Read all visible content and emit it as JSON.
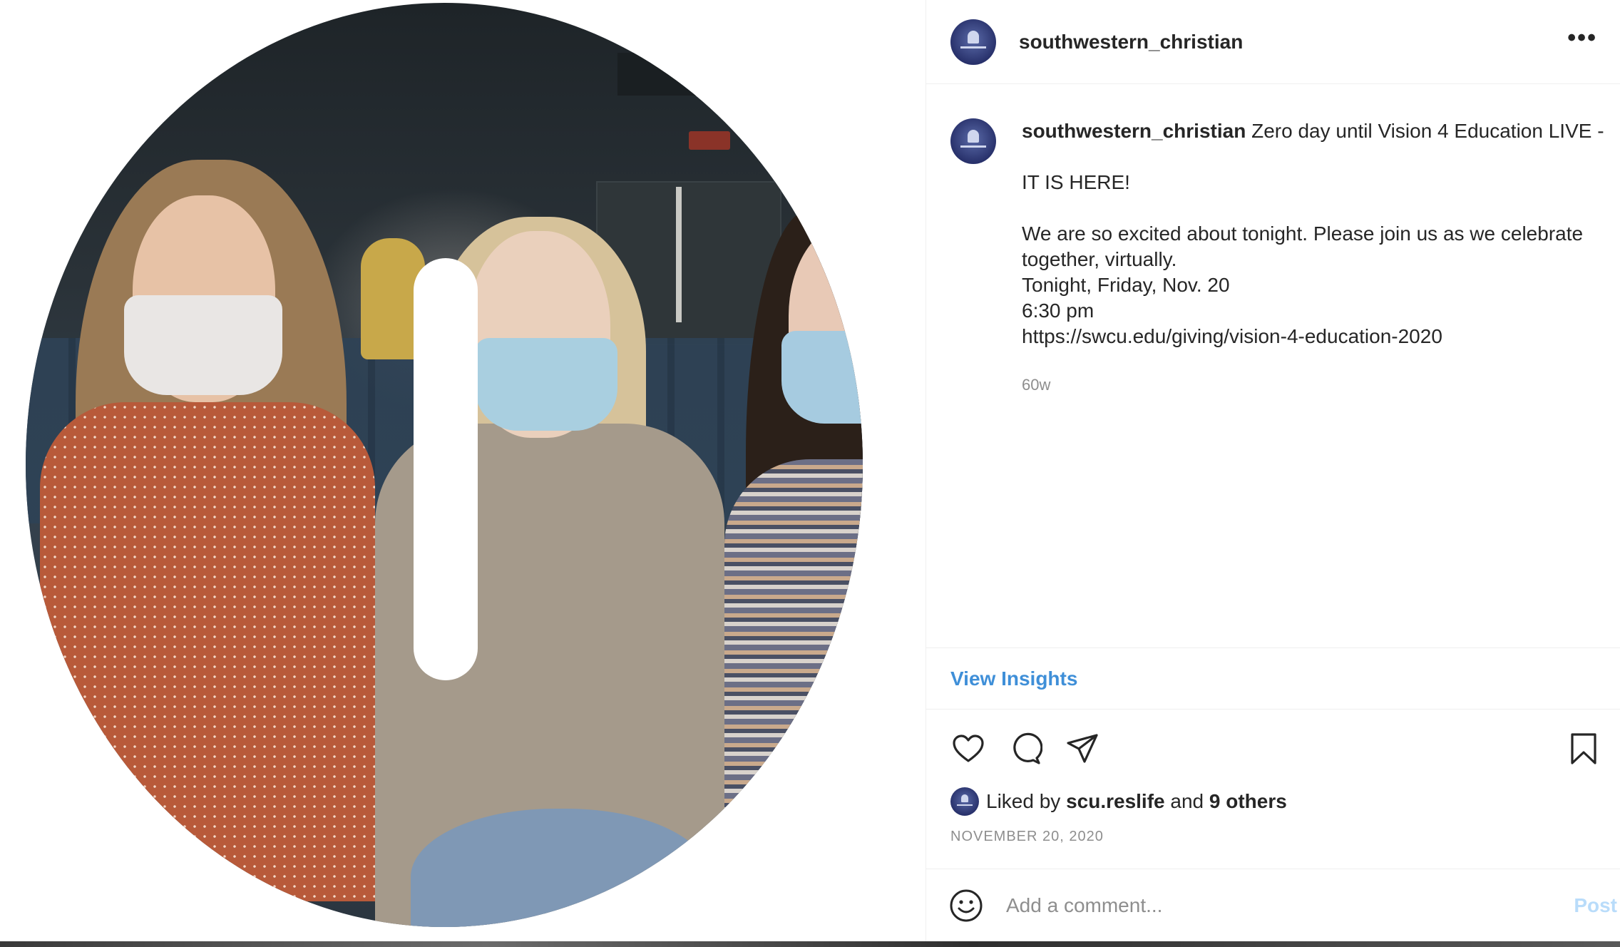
{
  "post": {
    "username": "southwestern_christian",
    "caption": {
      "username": "southwestern_christian",
      "lines": [
        "Zero day until Vision 4 Education LIVE -",
        "IT IS HERE!",
        "We are so excited about tonight. Please join us as we celebrate",
        "together, virtually.",
        "Tonight, Friday, Nov. 20",
        "6:30 pm",
        "https://swcu.edu/giving/vision-4-education-2020"
      ],
      "relative_time": "60w"
    },
    "insights_label": "View Insights",
    "likes": {
      "prefix": "Liked by",
      "first_liker": "scu.reslife",
      "connector": "and",
      "others": "9 others"
    },
    "date": "NOVEMBER 20, 2020",
    "comment": {
      "placeholder": "Add a comment...",
      "post_label": "Post"
    },
    "more_icon": "•••"
  },
  "colors": {
    "link_blue": "#3f8fd8",
    "post_disabled": "#b9dcfa",
    "muted": "#8e8e8e",
    "text": "#262626"
  },
  "icons": [
    "more-options-icon",
    "heart-icon",
    "comment-icon",
    "share-icon",
    "bookmark-icon",
    "emoji-icon"
  ]
}
